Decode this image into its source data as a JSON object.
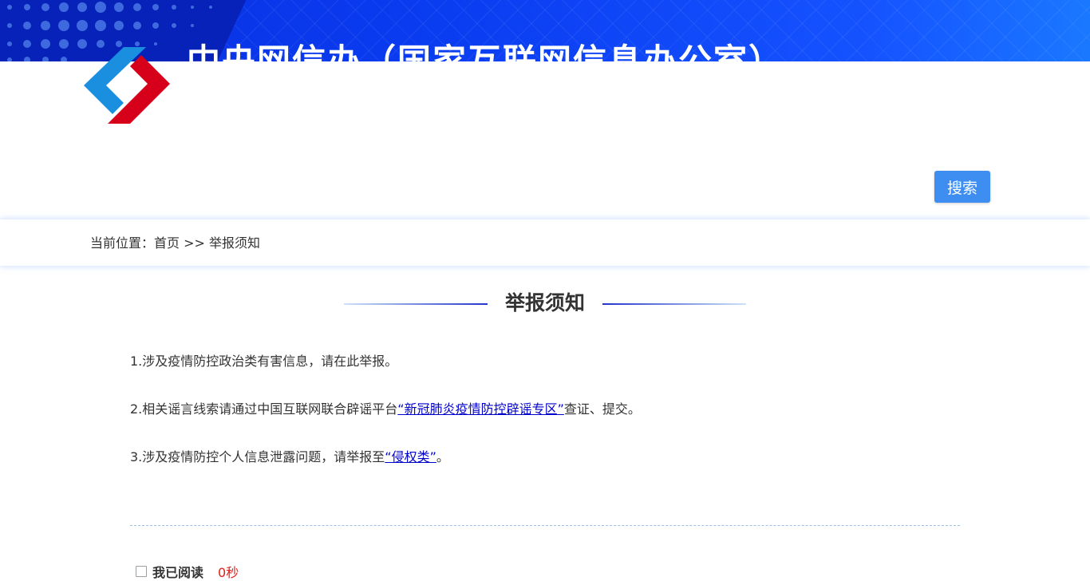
{
  "header": {
    "site_title": "中央网信办（国家互联网信息办公室）",
    "logo_icon": "cac-logo-icon",
    "colors": {
      "banner_blue": "#0a3cf0",
      "logo_blue": "#1a8fe0",
      "logo_red": "#d7001b",
      "button_blue": "#3d8ef0"
    }
  },
  "search": {
    "button_label": "搜索"
  },
  "breadcrumb": {
    "prefix": "当前位置：",
    "home": "首页",
    "separator": " >> ",
    "current": "举报须知"
  },
  "main": {
    "title": "举报须知",
    "notices": [
      {
        "text": "1.涉及疫情防控政治类有害信息，请在此举报。"
      },
      {
        "before": "2.相关谣言线索请通过中国互联网联合辟谣平台",
        "link": "“新冠肺炎疫情防控辟谣专区”",
        "after": "查证、提交。"
      },
      {
        "before": "3.涉及疫情防控个人信息泄露问题，请举报至",
        "link": "“侵权类”",
        "after": "。"
      }
    ],
    "agree": {
      "label": "我已阅读",
      "timer": "0秒"
    },
    "colors": {
      "link": "#0000cc",
      "timer_red": "#e0201a"
    }
  }
}
